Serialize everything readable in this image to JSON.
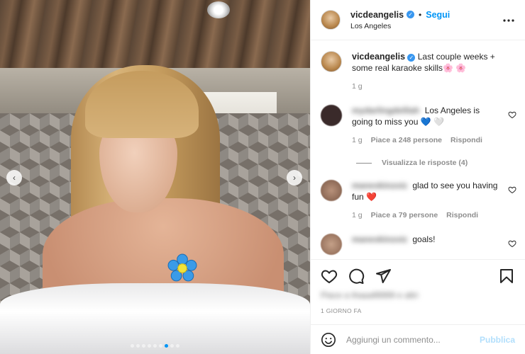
{
  "post": {
    "username": "vicdeangelis",
    "follow_label": "Segui",
    "separator": "•",
    "location": "Los Angeles",
    "more_icon": "more-horizontal-icon",
    "verified_glyph": "✓",
    "caption": "Last couple weeks + some real karaoke skills🌸 🌸",
    "caption_time": "1 g",
    "image_description_icons": [
      "chevron-left-icon",
      "chevron-right-icon"
    ],
    "nav_prev_glyph": "‹",
    "nav_next_glyph": "›",
    "carousel": {
      "count": 9,
      "active_index": 6
    }
  },
  "comments": [
    {
      "username": "mydarlingdelilah",
      "text": "Los Angeles is going to miss you 💙 🤍",
      "time": "1 g",
      "likes": "Piace a 248 persone",
      "reply_label": "Rispondi",
      "avatar_color": "#3a2a2a"
    },
    {
      "username": "maneskinzoiz",
      "text": "glad to see you having fun ❤️",
      "time": "1 g",
      "likes": "Piace a 79 persone",
      "reply_label": "Rispondi",
      "avatar_color": "#8a6a58"
    },
    {
      "username": "maneskinzoiz",
      "text": "goals!",
      "avatar_color": "#9a7a64"
    }
  ],
  "view_replies": "Visualizza le risposte (4)",
  "likes_summary": "Piace a thaaafill999 e altri",
  "date_label": "1 GIORNO FA",
  "add_comment": {
    "placeholder": "Aggiungi un commento...",
    "publish_label": "Pubblica"
  },
  "colors": {
    "accent": "#0095f6",
    "publish_disabled": "#b2dffc",
    "muted": "#8e8e8e"
  }
}
